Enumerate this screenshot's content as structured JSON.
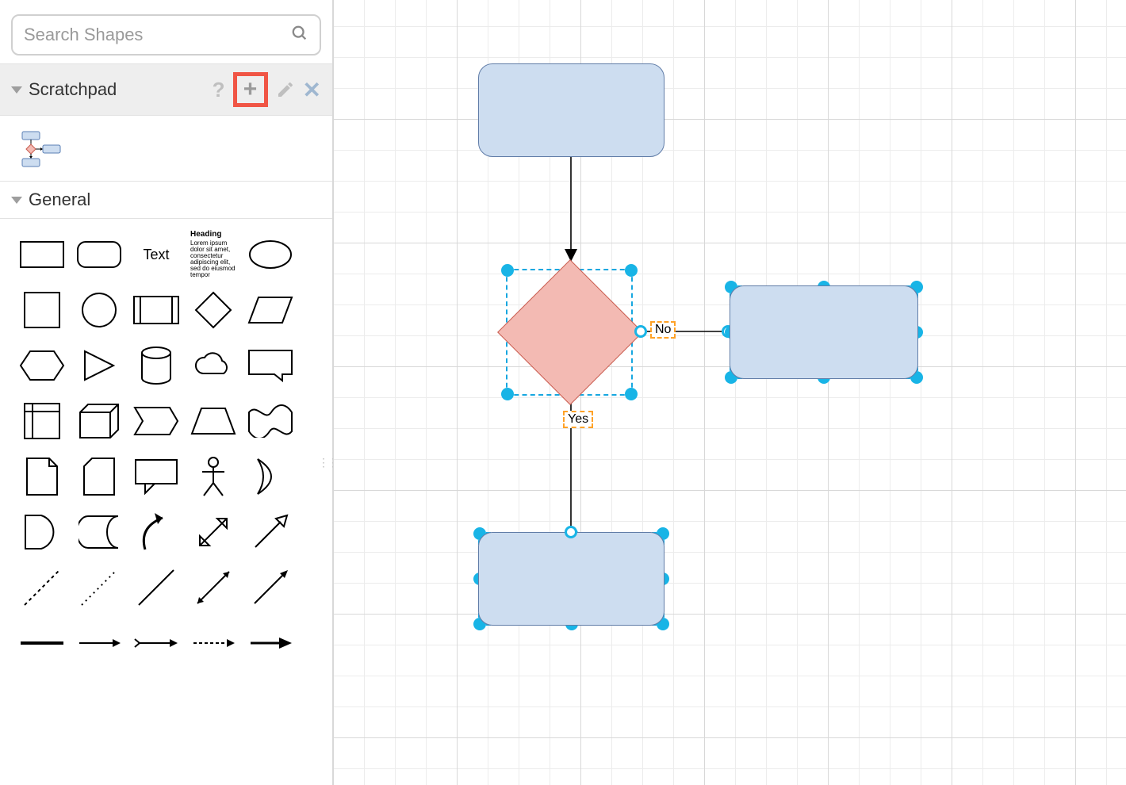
{
  "search": {
    "placeholder": "Search Shapes"
  },
  "sections": {
    "scratchpad": {
      "title": "Scratchpad",
      "help": "?",
      "add": "+",
      "close": "✕"
    },
    "general": {
      "title": "General"
    }
  },
  "palette": {
    "text_label": "Text",
    "heading_label": "Heading",
    "heading_body": "Lorem ipsum dolor sit amet, consectetur adipiscing elit, sed do eiusmod tempor"
  },
  "canvas": {
    "edge_labels": {
      "right": "No",
      "down": "Yes"
    }
  }
}
